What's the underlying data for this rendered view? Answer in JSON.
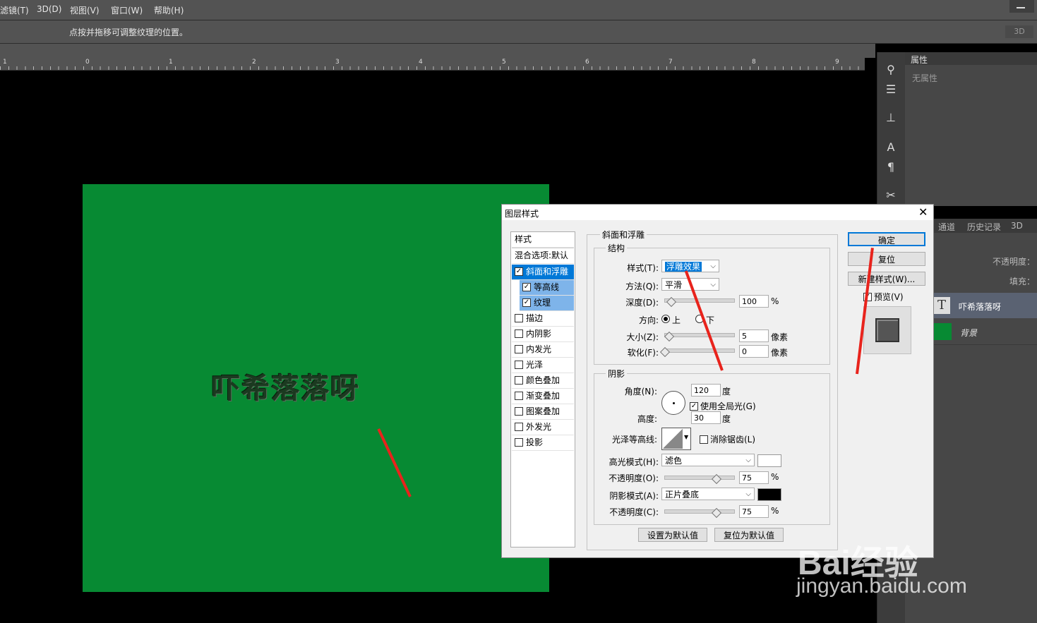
{
  "menubar": {
    "items": [
      "滤镜(T)",
      "3D(D)",
      "视图(V)",
      "窗口(W)",
      "帮助(H)"
    ]
  },
  "options_bar": {
    "hint": "点按并拖移可调整纹理的位置。",
    "mode_3d": "3D"
  },
  "ruler": {
    "labels": [
      "1",
      "0",
      "1",
      "2",
      "3",
      "4",
      "5",
      "6",
      "7",
      "8",
      "9"
    ]
  },
  "canvas": {
    "text_layer": "吓希落落呀",
    "doc_color": "#078a33"
  },
  "properties_panel": {
    "tab": "属性",
    "empty_text": "无属性"
  },
  "layers_panel": {
    "tabs": [
      "通道",
      "历史记录",
      "3D"
    ],
    "opacity_label": "不透明度：",
    "fill_label": "填充：",
    "layers": [
      {
        "name": "吓希落落呀",
        "type": "text"
      },
      {
        "name": "背景",
        "type": "background"
      }
    ]
  },
  "dialog": {
    "title": "图层样式",
    "styles_header": "样式",
    "blend_options": "混合选项:默认",
    "effects": [
      {
        "label": "斜面和浮雕",
        "checked": true,
        "active": true
      },
      {
        "label": "等高线",
        "checked": true,
        "sub": true
      },
      {
        "label": "纹理",
        "checked": true,
        "sub": true
      },
      {
        "label": "描边",
        "checked": false
      },
      {
        "label": "内阴影",
        "checked": false
      },
      {
        "label": "内发光",
        "checked": false
      },
      {
        "label": "光泽",
        "checked": false
      },
      {
        "label": "颜色叠加",
        "checked": false
      },
      {
        "label": "渐变叠加",
        "checked": false
      },
      {
        "label": "图案叠加",
        "checked": false
      },
      {
        "label": "外发光",
        "checked": false
      },
      {
        "label": "投影",
        "checked": false
      }
    ],
    "bevel": {
      "section": "斜面和浮雕",
      "structure": "结构",
      "style_label": "样式(T):",
      "style_value": "浮雕效果",
      "technique_label": "方法(Q):",
      "technique_value": "平滑",
      "depth_label": "深度(D):",
      "depth_value": "100",
      "depth_unit": "%",
      "direction_label": "方向:",
      "dir_up": "上",
      "dir_down": "下",
      "size_label": "大小(Z):",
      "size_value": "5",
      "size_unit": "像素",
      "soften_label": "软化(F):",
      "soften_value": "0",
      "soften_unit": "像素"
    },
    "shading": {
      "section": "阴影",
      "angle_label": "角度(N):",
      "angle_value": "120",
      "angle_unit": "度",
      "global_light": "使用全局光(G)",
      "altitude_label": "高度:",
      "altitude_value": "30",
      "altitude_unit": "度",
      "gloss_label": "光泽等高线:",
      "antialias": "消除锯齿(L)",
      "highlight_label": "高光模式(H):",
      "highlight_value": "滤色",
      "highlight_color": "#ffffff",
      "hl_opacity_label": "不透明度(O):",
      "hl_opacity_value": "75",
      "hl_unit": "%",
      "shadow_label": "阴影模式(A):",
      "shadow_value": "正片叠底",
      "shadow_color": "#000000",
      "sh_opacity_label": "不透明度(C):",
      "sh_opacity_value": "75",
      "sh_unit": "%"
    },
    "buttons": {
      "make_default": "设置为默认值",
      "reset_default": "复位为默认值",
      "ok": "确定",
      "reset": "复位",
      "new_style": "新建样式(W)...",
      "preview": "预览(V)"
    }
  },
  "watermark": {
    "brand": "Bai经验",
    "url": "jingyan.baidu.com"
  }
}
